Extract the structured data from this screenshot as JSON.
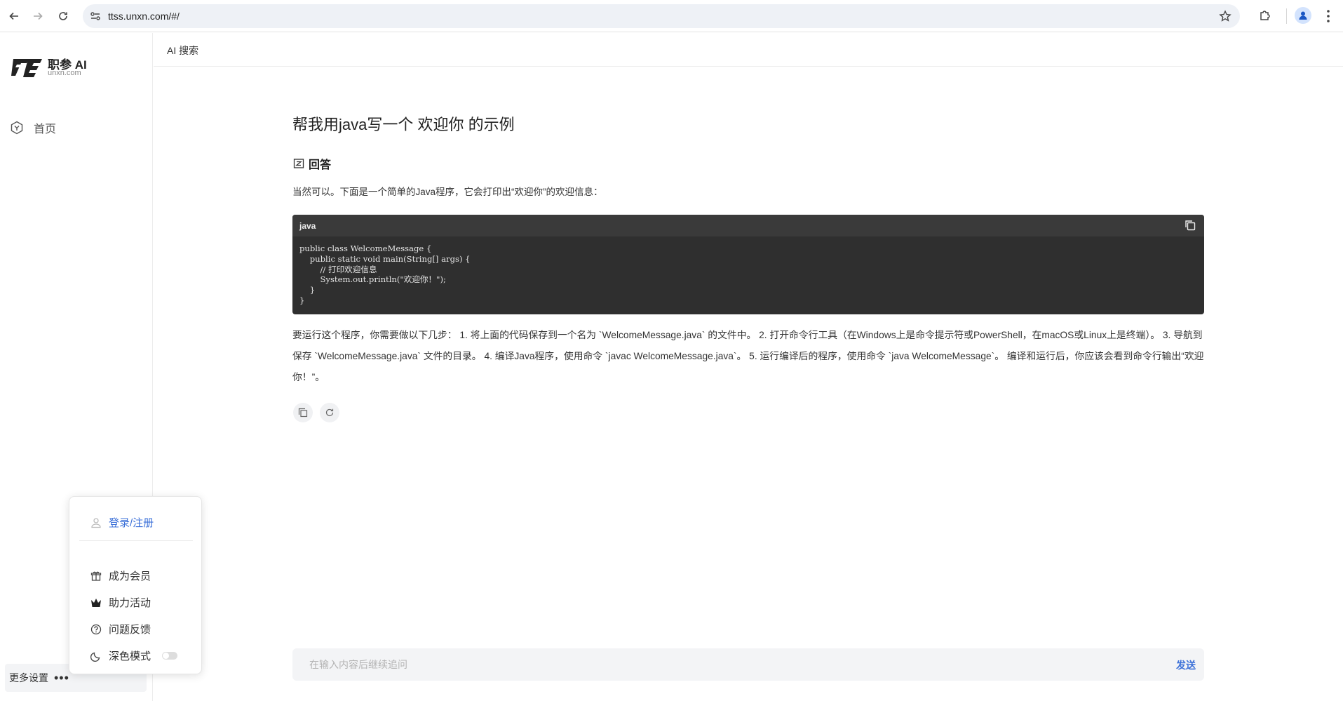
{
  "browser": {
    "url": "ttss.unxn.com/#/"
  },
  "sidebar": {
    "brand_name": "职参 AI",
    "brand_sub": "unxn.com",
    "home_label": "首页",
    "more_settings_label": "更多设置",
    "more_settings_dots": "•••"
  },
  "popup": {
    "login_label": "登录/注册",
    "items": [
      {
        "label": "成为会员",
        "icon": "gift-icon"
      },
      {
        "label": "助力活动",
        "icon": "crown-icon"
      },
      {
        "label": "问题反馈",
        "icon": "question-icon"
      },
      {
        "label": "深色模式",
        "icon": "moon-icon"
      }
    ],
    "dark_mode_on": false
  },
  "header": {
    "title": "AI 搜索"
  },
  "main": {
    "question": "帮我用java写一个 欢迎你 的示例",
    "answer_heading": "回答",
    "intro": "当然可以。下面是一个简单的Java程序，它会打印出“欢迎你”的欢迎信息：",
    "code_lang": "java",
    "code": "public class WelcomeMessage {\n    public static void main(String[] args) {\n        // 打印欢迎信息\n        System.out.println(\"欢迎你！\");\n    }\n}",
    "instructions": "要运行这个程序，你需要做以下几步： 1. 将上面的代码保存到一个名为 `WelcomeMessage.java` 的文件中。 2. 打开命令行工具（在Windows上是命令提示符或PowerShell，在macOS或Linux上是终端）。 3. 导航到保存 `WelcomeMessage.java` 文件的目录。 4. 编译Java程序，使用命令 `javac WelcomeMessage.java`。 5. 运行编译后的程序，使用命令 `java WelcomeMessage`。 编译和运行后，你应该会看到命令行输出“欢迎你！”。"
  },
  "composer": {
    "placeholder": "在输入内容后继续追问",
    "value": "",
    "send_label": "发送"
  },
  "colors": {
    "accent": "#3a6fd8",
    "code_bg": "#2f2f2f",
    "code_header_bg": "#3a3a3a"
  }
}
